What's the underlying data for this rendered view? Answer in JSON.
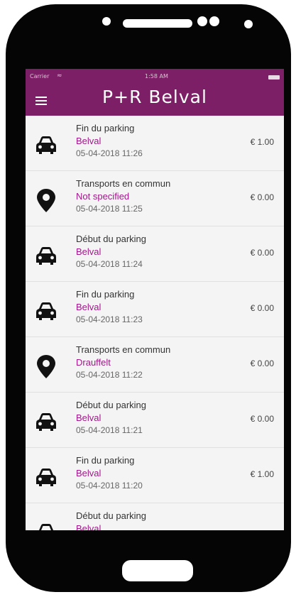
{
  "status_bar": {
    "carrier": "Carrier",
    "time": "1:58 AM"
  },
  "header": {
    "title": "P+R Belval"
  },
  "items": [
    {
      "icon": "car-icon",
      "title": "Fin du parking",
      "location": "Belval",
      "date": "05-04-2018 11:26",
      "price": "€ 1.00"
    },
    {
      "icon": "location-pin-icon",
      "title": "Transports en commun",
      "location": "Not specified",
      "date": "05-04-2018 11:25",
      "price": "€ 0.00"
    },
    {
      "icon": "car-icon",
      "title": "Début du parking",
      "location": "Belval",
      "date": "05-04-2018 11:24",
      "price": "€ 0.00"
    },
    {
      "icon": "car-icon",
      "title": "Fin du parking",
      "location": "Belval",
      "date": "05-04-2018 11:23",
      "price": "€ 0.00"
    },
    {
      "icon": "location-pin-icon",
      "title": "Transports en commun",
      "location": "Drauffelt",
      "date": "05-04-2018 11:22",
      "price": "€ 0.00"
    },
    {
      "icon": "car-icon",
      "title": "Début du parking",
      "location": "Belval",
      "date": "05-04-2018 11:21",
      "price": "€ 0.00"
    },
    {
      "icon": "car-icon",
      "title": "Fin du parking",
      "location": "Belval",
      "date": "05-04-2018 11:20",
      "price": "€ 1.00"
    },
    {
      "icon": "car-icon",
      "title": "Début du parking",
      "location": "Belval",
      "date": "",
      "price": ""
    }
  ]
}
